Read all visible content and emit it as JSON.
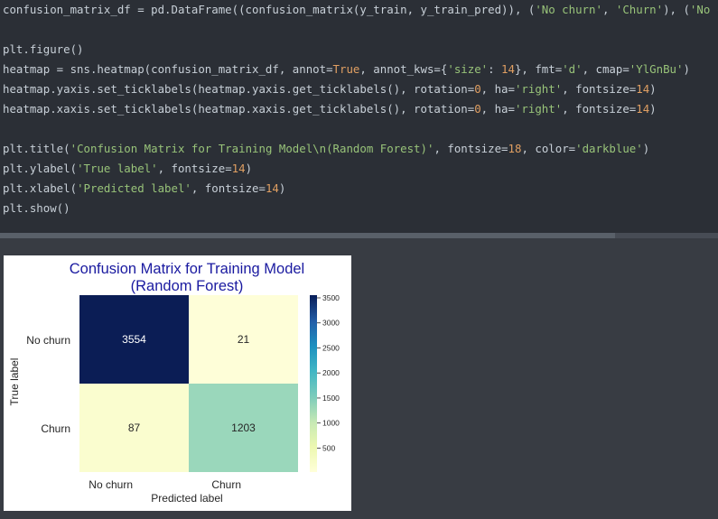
{
  "code": {
    "lines": [
      [
        {
          "t": "confusion_matrix_df = pd.DataFrame((confusion_matrix(y_train, y_train_pred)), (",
          "c": ""
        },
        {
          "t": "'No churn'",
          "c": "s"
        },
        {
          "t": ", ",
          "c": ""
        },
        {
          "t": "'Churn'",
          "c": "s"
        },
        {
          "t": "), (",
          "c": ""
        },
        {
          "t": "'No c",
          "c": "s"
        }
      ],
      [],
      [
        {
          "t": "plt.figure()",
          "c": ""
        }
      ],
      [
        {
          "t": "heatmap = sns.heatmap(confusion_matrix_df, annot=",
          "c": ""
        },
        {
          "t": "True",
          "c": "k"
        },
        {
          "t": ", annot_kws={",
          "c": ""
        },
        {
          "t": "'size'",
          "c": "s"
        },
        {
          "t": ": ",
          "c": ""
        },
        {
          "t": "14",
          "c": "n"
        },
        {
          "t": "}, fmt=",
          "c": ""
        },
        {
          "t": "'d'",
          "c": "s"
        },
        {
          "t": ", cmap=",
          "c": ""
        },
        {
          "t": "'YlGnBu'",
          "c": "s"
        },
        {
          "t": ")",
          "c": ""
        }
      ],
      [
        {
          "t": "heatmap.yaxis.set_ticklabels(heatmap.yaxis.get_ticklabels(), rotation=",
          "c": ""
        },
        {
          "t": "0",
          "c": "n"
        },
        {
          "t": ", ha=",
          "c": ""
        },
        {
          "t": "'right'",
          "c": "s"
        },
        {
          "t": ", fontsize=",
          "c": ""
        },
        {
          "t": "14",
          "c": "n"
        },
        {
          "t": ")",
          "c": ""
        }
      ],
      [
        {
          "t": "heatmap.xaxis.set_ticklabels(heatmap.xaxis.get_ticklabels(), rotation=",
          "c": ""
        },
        {
          "t": "0",
          "c": "n"
        },
        {
          "t": ", ha=",
          "c": ""
        },
        {
          "t": "'right'",
          "c": "s"
        },
        {
          "t": ", fontsize=",
          "c": ""
        },
        {
          "t": "14",
          "c": "n"
        },
        {
          "t": ")",
          "c": ""
        }
      ],
      [],
      [
        {
          "t": "plt.title(",
          "c": ""
        },
        {
          "t": "'Confusion Matrix for Training Model\\n(Random Forest)'",
          "c": "s"
        },
        {
          "t": ", fontsize=",
          "c": ""
        },
        {
          "t": "18",
          "c": "n"
        },
        {
          "t": ", color=",
          "c": ""
        },
        {
          "t": "'darkblue'",
          "c": "s"
        },
        {
          "t": ")",
          "c": ""
        }
      ],
      [
        {
          "t": "plt.ylabel(",
          "c": ""
        },
        {
          "t": "'True label'",
          "c": "s"
        },
        {
          "t": ", fontsize=",
          "c": ""
        },
        {
          "t": "14",
          "c": "n"
        },
        {
          "t": ")",
          "c": ""
        }
      ],
      [
        {
          "t": "plt.xlabel(",
          "c": ""
        },
        {
          "t": "'Predicted label'",
          "c": "s"
        },
        {
          "t": ", fontsize=",
          "c": ""
        },
        {
          "t": "14",
          "c": "n"
        },
        {
          "t": ")",
          "c": ""
        }
      ],
      [
        {
          "t": "plt.show()",
          "c": ""
        }
      ]
    ]
  },
  "colors": {
    "code_bg": "#2b2f36",
    "output_bg": "#383c43",
    "string": "#98c379",
    "number": "#e09f62",
    "title": "#1a1aa0"
  },
  "chart_data": {
    "type": "heatmap",
    "title": "Confusion Matrix for Training Model\n(Random Forest)",
    "title_lines": [
      "Confusion Matrix for Training Model",
      "(Random Forest)"
    ],
    "xlabel": "Predicted label",
    "ylabel": "True label",
    "x_categories": [
      "No churn",
      "Churn"
    ],
    "y_categories": [
      "No churn",
      "Churn"
    ],
    "values": [
      [
        3554,
        21
      ],
      [
        87,
        1203
      ]
    ],
    "colormap": "YlGnBu",
    "colorbar_ticks": [
      500,
      1000,
      1500,
      2000,
      2500,
      3000,
      3500
    ],
    "colorbar_range": [
      21,
      3554
    ],
    "cell_colors": [
      [
        "#0b1d55",
        "#fefed8"
      ],
      [
        "#fafdcf",
        "#9ad7bb"
      ]
    ],
    "text_colors": [
      [
        "#ffffff",
        "#262626"
      ],
      [
        "#262626",
        "#262626"
      ]
    ]
  }
}
